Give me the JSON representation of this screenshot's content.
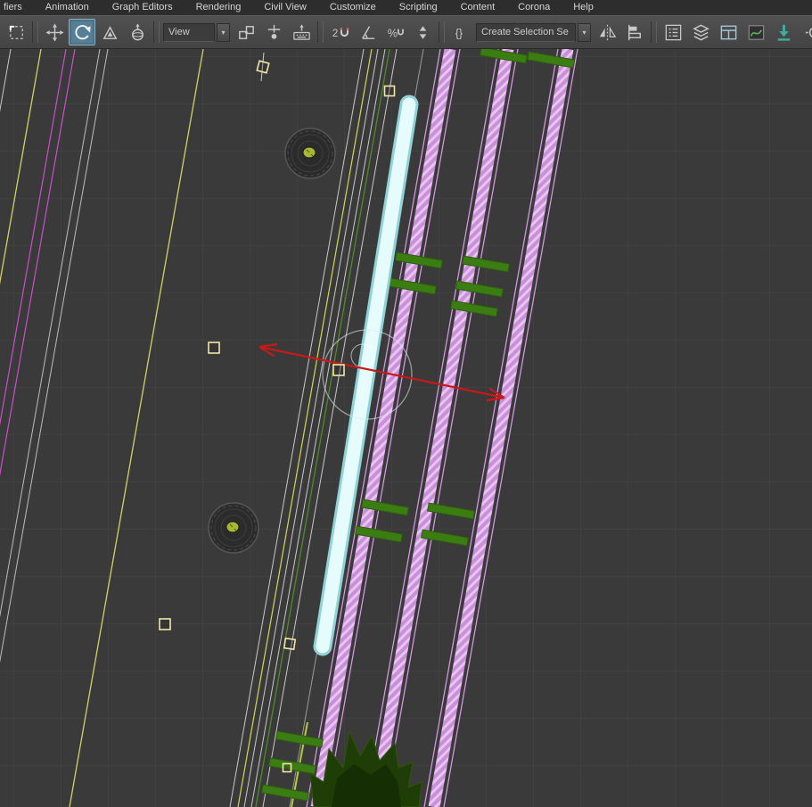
{
  "menubar": {
    "items": [
      "fiers",
      "Animation",
      "Graph Editors",
      "Rendering",
      "Civil View",
      "Customize",
      "Scripting",
      "Content",
      "Corona",
      "Help"
    ]
  },
  "toolbar": {
    "coordinate_system_value": "View",
    "selection_set_value": "Create Selection Se",
    "dropdown_arrow": "▾",
    "snap_mode_label": "2",
    "percent_label": "%",
    "braces_label": "{}",
    "active_tool": "select-and-rotate",
    "icons": [
      "marquee-select",
      "select-and-move",
      "select-and-rotate",
      "select-and-scale",
      "select-and-place",
      "use-pivot-point-center",
      "select-and-manipulate",
      "keyboard-shortcut-override",
      "snaps-toggle",
      "angle-snap",
      "percent-snap",
      "spinner-snap",
      "edit-named-selection-sets",
      "mirror",
      "align",
      "toggle-scene-explorer",
      "toggle-layer-explorer",
      "toggle-ribbon",
      "curve-editor",
      "schematic-view",
      "clipped"
    ]
  },
  "viewport": {
    "colors": {
      "background": "#3a3a3a",
      "grid": "#464646",
      "road_edge_white": "#c9c9c9",
      "lane_yellow": "#d6d65a",
      "vegetation_green": "#4e8c28",
      "sleeper_green": "#3b7d12",
      "track_pink": "#c98fd8",
      "track_pink_light": "#e8c4f0",
      "selection_cyan": "#e6fbfb",
      "measure_red": "#c81919",
      "magenta": "#cc4fcc",
      "handle_yellow": "#f2e6a8"
    }
  }
}
